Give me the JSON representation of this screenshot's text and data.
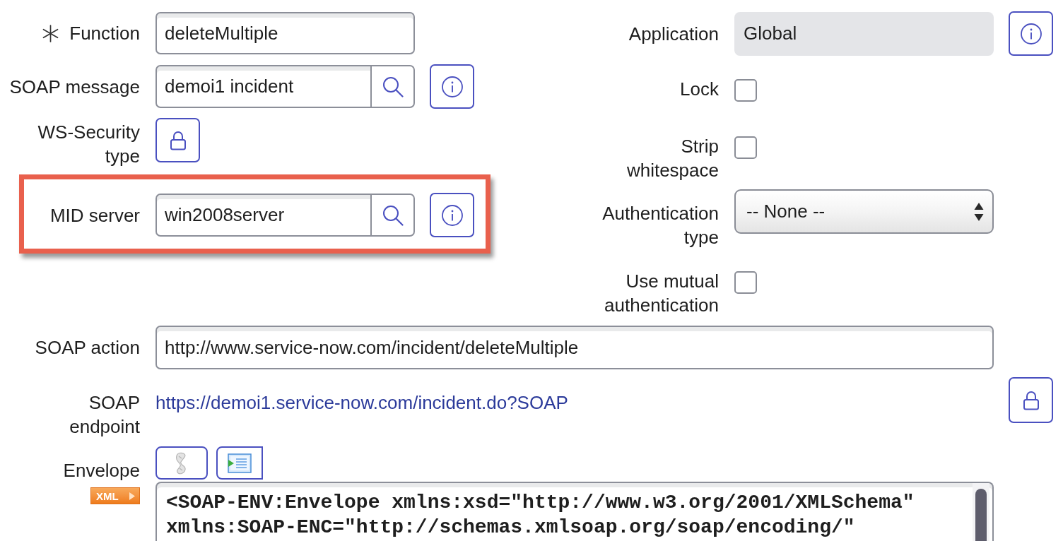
{
  "left_fields": [
    {
      "kind": "text",
      "label": "Function",
      "required": true,
      "value": "deleteMultiple",
      "info": false,
      "highlighted": false
    },
    {
      "kind": "reference",
      "label": "SOAP message",
      "required": false,
      "value": "demoi1 incident",
      "info": true,
      "highlighted": false
    },
    {
      "kind": "lock",
      "label": "WS-Security type",
      "required": false,
      "info": false,
      "highlighted": false
    },
    {
      "kind": "reference",
      "label": "MID server",
      "required": false,
      "value": "win2008server",
      "info": true,
      "highlighted": true
    }
  ],
  "right_fields": [
    {
      "kind": "readonly",
      "label": "Application",
      "value": "Global",
      "info": true
    },
    {
      "kind": "checkbox",
      "label": "Lock",
      "checked": false,
      "info": false
    },
    {
      "kind": "checkbox",
      "label": "Strip whitespace",
      "checked": false,
      "info": false
    },
    {
      "kind": "select",
      "label": "Authentication type",
      "value": "-- None --",
      "info": false
    },
    {
      "kind": "checkbox",
      "label": "Use mutual authentication",
      "checked": false,
      "info": false
    }
  ],
  "soap_action": {
    "label": "SOAP action",
    "value": "http://www.service-now.com/incident/deleteMultiple"
  },
  "soap_endpoint": {
    "label": "SOAP endpoint",
    "url": "https://demoi1.service-now.com/incident.do?SOAP"
  },
  "envelope": {
    "label": "Envelope",
    "format_tag": "XML",
    "lines": [
      "<SOAP-ENV:Envelope xmlns:xsd=\"http://www.w3.org/2001/XMLSchema\"",
      "xmlns:SOAP-ENC=\"http://schemas.xmlsoap.org/soap/encoding/\""
    ]
  }
}
